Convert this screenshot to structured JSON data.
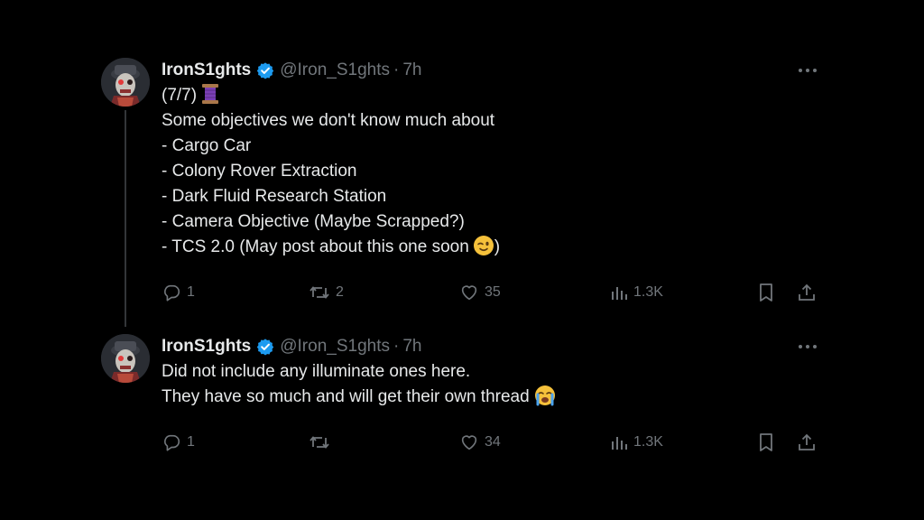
{
  "tweets": [
    {
      "author": {
        "name": "IronS1ghts",
        "handle": "@Iron_S1ghts",
        "time": "7h",
        "verified": true
      },
      "lines": [
        "(7/7)",
        "Some objectives we don't know much about",
        "- Cargo Car",
        "- Colony Rover Extraction",
        "- Dark Fluid Research Station",
        "- Camera Objective (Maybe Scrapped?)",
        "- TCS 2.0 (May post about this one soon",
        ")"
      ],
      "emojis": [
        "thread-spool-emoji",
        "winking-face-emoji"
      ],
      "stats": {
        "replies": "1",
        "reposts": "2",
        "likes": "35",
        "views": "1.3K"
      }
    },
    {
      "author": {
        "name": "IronS1ghts",
        "handle": "@Iron_S1ghts",
        "time": "7h",
        "verified": true
      },
      "lines": [
        "Did not include any illuminate ones here.",
        "They have so much and will get their own thread"
      ],
      "emojis": [
        "loudly-crying-face-emoji"
      ],
      "stats": {
        "replies": "1",
        "reposts": "",
        "likes": "34",
        "views": "1.3K"
      }
    }
  ],
  "icons": {
    "more": "more-horizontal-icon",
    "reply": "reply-icon",
    "repost": "repost-icon",
    "like": "heart-icon",
    "views": "views-icon",
    "bookmark": "bookmark-icon",
    "share": "share-icon",
    "verified": "verified-badge-icon"
  },
  "colors": {
    "background": "#000000",
    "text": "#e7e9ea",
    "muted": "#71767b",
    "verified": "#1d9bf0",
    "thread_line": "#333639"
  }
}
